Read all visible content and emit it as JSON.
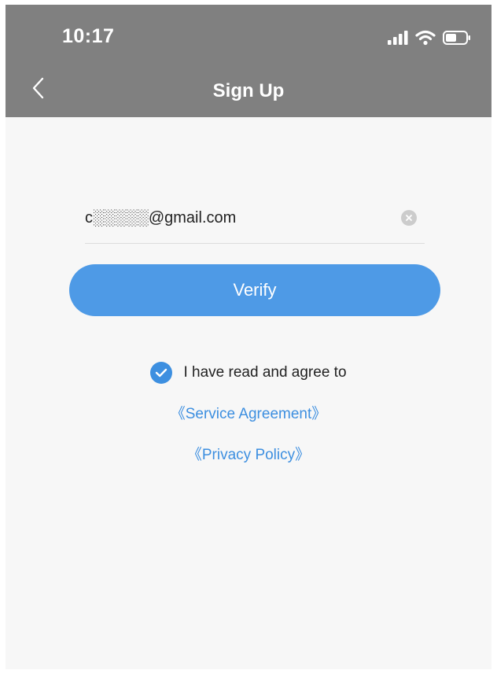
{
  "status_bar": {
    "time": "10:17",
    "icons": [
      "signal-icon",
      "wifi-icon",
      "battery-icon"
    ]
  },
  "nav": {
    "back_icon": "chevron-left-icon",
    "title": "Sign Up"
  },
  "email": {
    "value": "c░░░░░@gmail.com",
    "clear_icon": "clear-icon"
  },
  "verify": {
    "label": "Verify"
  },
  "agreement": {
    "checked": true,
    "text": "I have read and agree to",
    "service_link": "《Service Agreement》",
    "privacy_link": "《Privacy Policy》"
  },
  "colors": {
    "header": "#808080",
    "accent": "#3d8fe0",
    "button": "#4e9ae6",
    "background": "#f7f7f7"
  }
}
